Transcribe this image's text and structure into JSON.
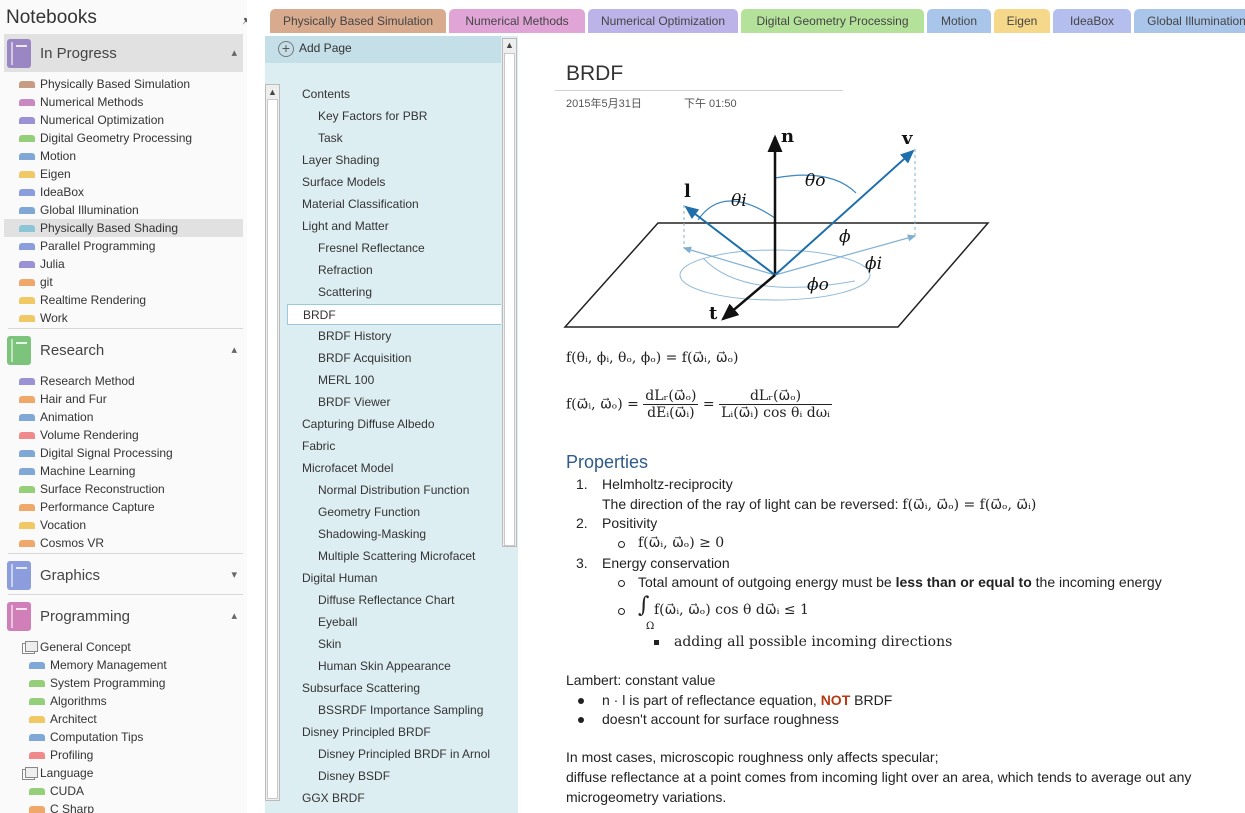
{
  "notebooks_pane": {
    "title": "Notebooks",
    "pin_icon": "pin-icon",
    "notebooks": [
      {
        "name": "In Progress",
        "color": "#9b86c4",
        "expanded": true,
        "sections": [
          {
            "label": "Physically Based Simulation",
            "color": "#c89c82"
          },
          {
            "label": "Numerical Methods",
            "color": "#c889c0"
          },
          {
            "label": "Numerical Optimization",
            "color": "#9b92d6"
          },
          {
            "label": "Digital Geometry Processing",
            "color": "#96cf7a"
          },
          {
            "label": "Motion",
            "color": "#7fa8d6"
          },
          {
            "label": "Eigen",
            "color": "#f0c864"
          },
          {
            "label": "IdeaBox",
            "color": "#8b9ddc"
          },
          {
            "label": "Global Illumination",
            "color": "#7fa8d6"
          },
          {
            "label": "Physically Based Shading",
            "color": "#8cc6d6",
            "selected": true
          },
          {
            "label": "Parallel Programming",
            "color": "#8b9ddc"
          },
          {
            "label": "Julia",
            "color": "#9b92d6"
          },
          {
            "label": "git",
            "color": "#f0a86a"
          },
          {
            "label": "Realtime Rendering",
            "color": "#f0c864"
          },
          {
            "label": "Work",
            "color": "#f0c864"
          }
        ]
      },
      {
        "name": "Research",
        "color": "#7cc47c",
        "expanded": true,
        "sections": [
          {
            "label": "Research Method",
            "color": "#9b92d6"
          },
          {
            "label": "Hair and Fur",
            "color": "#f0a86a"
          },
          {
            "label": "Animation",
            "color": "#7fa8d6"
          },
          {
            "label": "Volume Rendering",
            "color": "#f08a8a"
          },
          {
            "label": "Digital Signal Processing",
            "color": "#7fa8d6"
          },
          {
            "label": "Machine Learning",
            "color": "#7fa8d6"
          },
          {
            "label": "Surface Reconstruction",
            "color": "#96cf7a"
          },
          {
            "label": "Performance Capture",
            "color": "#f0a86a"
          },
          {
            "label": "Vocation",
            "color": "#f0c864"
          },
          {
            "label": "Cosmos VR",
            "color": "#f0a86a"
          }
        ]
      },
      {
        "name": "Graphics",
        "color": "#8b9ddc",
        "expanded": false,
        "sections": []
      },
      {
        "name": "Programming",
        "color": "#d07fb8",
        "expanded": true,
        "sections": [
          {
            "label": "General Concept",
            "group": true
          },
          {
            "label": "Memory Management",
            "color": "#7fa8d6",
            "indent": true
          },
          {
            "label": "System Programming",
            "color": "#96cf7a",
            "indent": true
          },
          {
            "label": "Algorithms",
            "color": "#96cf7a",
            "indent": true
          },
          {
            "label": "Architect",
            "color": "#f0c864",
            "indent": true
          },
          {
            "label": "Computation Tips",
            "color": "#7fa8d6",
            "indent": true
          },
          {
            "label": "Profiling",
            "color": "#f08a8a",
            "indent": true
          },
          {
            "label": "Language",
            "group": true
          },
          {
            "label": "CUDA",
            "color": "#96cf7a",
            "indent": true
          },
          {
            "label": "C Sharp",
            "color": "#f0a86a",
            "indent": true
          }
        ]
      }
    ]
  },
  "section_tabs": [
    {
      "label": "Physically Based Simulation",
      "color": "#d9ab8e",
      "active": true
    },
    {
      "label": "Numerical Methods",
      "color": "#e0a5d6"
    },
    {
      "label": "Numerical Optimization",
      "color": "#bcb3e8"
    },
    {
      "label": "Digital Geometry Processing",
      "color": "#b5e29b"
    },
    {
      "label": "Motion",
      "color": "#a9c6ea"
    },
    {
      "label": "Eigen",
      "color": "#f5d889"
    },
    {
      "label": "IdeaBox",
      "color": "#b4bfee"
    },
    {
      "label": "Global Illumination",
      "color": "#a9c6ea"
    }
  ],
  "page_pane": {
    "add_page_label": "Add Page",
    "pages": [
      {
        "label": "Contents",
        "level": 1
      },
      {
        "label": "Key Factors for PBR",
        "level": 2
      },
      {
        "label": "Task",
        "level": 2
      },
      {
        "label": "Layer Shading",
        "level": 1
      },
      {
        "label": "Surface Models",
        "level": 1
      },
      {
        "label": "Material Classification",
        "level": 1
      },
      {
        "label": "Light and Matter",
        "level": 1
      },
      {
        "label": "Fresnel Reflectance",
        "level": 2
      },
      {
        "label": "Refraction",
        "level": 2
      },
      {
        "label": "Scattering",
        "level": 2
      },
      {
        "label": "BRDF",
        "level": 1,
        "current": true
      },
      {
        "label": "BRDF History",
        "level": 2
      },
      {
        "label": "BRDF Acquisition",
        "level": 2
      },
      {
        "label": "MERL 100",
        "level": 2
      },
      {
        "label": "BRDF Viewer",
        "level": 2
      },
      {
        "label": "Capturing Diffuse Albedo",
        "level": 1
      },
      {
        "label": "Fabric",
        "level": 1
      },
      {
        "label": "Microfacet Model",
        "level": 1
      },
      {
        "label": "Normal Distribution Function",
        "level": 2
      },
      {
        "label": "Geometry Function",
        "level": 2
      },
      {
        "label": "Shadowing-Masking",
        "level": 2
      },
      {
        "label": "Multiple Scattering Microfacet",
        "level": 2
      },
      {
        "label": "Digital Human",
        "level": 1
      },
      {
        "label": "Diffuse Reflectance Chart",
        "level": 2
      },
      {
        "label": "Eyeball",
        "level": 2
      },
      {
        "label": "Skin",
        "level": 2
      },
      {
        "label": "Human Skin Appearance",
        "level": 2
      },
      {
        "label": "Subsurface Scattering",
        "level": 1
      },
      {
        "label": "BSSRDF Importance Sampling",
        "level": 2
      },
      {
        "label": "Disney Principled BRDF",
        "level": 1
      },
      {
        "label": "Disney Principled BRDF in Arnol",
        "level": 2
      },
      {
        "label": "Disney BSDF",
        "level": 2
      },
      {
        "label": "GGX BRDF",
        "level": 1
      }
    ]
  },
  "note": {
    "title": "BRDF",
    "date": "2015年5月31日",
    "time": "下午 01:50",
    "diagram": {
      "n": "n",
      "v": "v",
      "l": "l",
      "t": "t",
      "theta_i": "θi",
      "theta_o": "θo",
      "phi": "ϕ",
      "phi_i": "ϕi",
      "phi_o": "ϕo"
    },
    "eq1": "f(θᵢ, ϕᵢ, θₒ, ϕₒ) = f(ω⃗ᵢ, ω⃗ₒ)",
    "eq2_lhs": "f(ω⃗ᵢ, ω⃗ₒ) =",
    "eq2_num1": "dLᵣ(ω⃗ₒ)",
    "eq2_den1": "dEᵢ(ω⃗ᵢ)",
    "eq2_eq": "=",
    "eq2_num2": "dLᵣ(ω⃗ₒ)",
    "eq2_den2": "Lᵢ(ω⃗ᵢ) cos θᵢ dωᵢ",
    "properties_heading": "Properties",
    "p1_num": "1.",
    "p1_title": "Helmholtz-reciprocity",
    "p1_desc": "The direction of the ray of light can be reversed:",
    "p1_eq": "f(ω⃗ᵢ, ω⃗ₒ) = f(ω⃗ₒ, ω⃗ᵢ)",
    "p2_num": "2.",
    "p2_title": "Positivity",
    "p2_eq": "f(ω⃗ᵢ, ω⃗ₒ) ≥ 0",
    "p3_num": "3.",
    "p3_title": "Energy conservation",
    "p3_b1_pre": "Total amount of outgoing energy must be",
    "p3_b1_bold": "less than or equal to",
    "p3_b1_post": "the incoming energy",
    "p3_b2_int": "∫",
    "p3_b2_sub": "Ω",
    "p3_b2_eq": "f(ω⃗ᵢ, ω⃗ₒ) cos θ dω⃗ᵢ ≤ 1",
    "p3_b2_sub_item": "adding all possible incoming directions",
    "lambert": "Lambert: constant value",
    "lambert_b1_pre": "n · l is part of reflectance equation,",
    "lambert_b1_not": "NOT",
    "lambert_b1_post": "BRDF",
    "lambert_b2": "doesn't account for surface roughness",
    "para1": "In most cases, microscopic roughness only affects specular;",
    "para2": "diffuse reflectance at a point comes from incoming light over an area, which tends to average out any",
    "para3": "microgeometry variations."
  }
}
